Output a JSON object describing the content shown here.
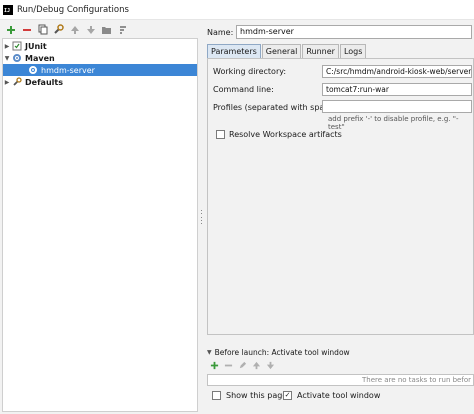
{
  "window": {
    "title": "Run/Debug Configurations",
    "app_icon_text": "IJ"
  },
  "toolbar": {
    "buttons": [
      "add-icon",
      "remove-icon",
      "copy-icon",
      "wrench-icon",
      "move-up-icon",
      "move-down-icon",
      "folder-icon",
      "sort-icon"
    ],
    "add_color": "#3a9a3a",
    "remove_color": "#d23b3b"
  },
  "tree": {
    "junit": {
      "label": "JUnit",
      "arrow": "▶"
    },
    "maven": {
      "label": "Maven",
      "arrow": "▼"
    },
    "hmdm": {
      "label": "hmdm-server"
    },
    "defaults": {
      "label": "Defaults",
      "arrow": "▶"
    },
    "selected_color": "#3c86d6"
  },
  "form": {
    "name_label": "Name:",
    "name_value": "hmdm-server",
    "tabs": [
      {
        "label": "Parameters",
        "active": true
      },
      {
        "label": "General"
      },
      {
        "label": "Runner"
      },
      {
        "label": "Logs"
      }
    ],
    "working_dir_label": "Working directory:",
    "working_dir_value": "C:/src/hmdm/android-kiosk-web/server",
    "command_line_label": "Command line:",
    "command_line_value": "tomcat7:run-war",
    "profiles_label": "Profiles (separated with space):",
    "profiles_value": "",
    "profiles_hint": "add prefix '-' to disable profile, e.g. \"-test\"",
    "resolve_label": "Resolve Workspace artifacts",
    "resolve_checked": false
  },
  "before_launch": {
    "header": "Before launch: Activate tool window",
    "empty_text": "There are no tasks to run befor",
    "buttons": [
      "add-icon",
      "remove-icon",
      "edit-icon",
      "move-up-icon",
      "move-down-icon"
    ],
    "show_page_label": "Show this page",
    "show_page_checked": false,
    "activate_label": "Activate tool window",
    "activate_checked": true
  }
}
